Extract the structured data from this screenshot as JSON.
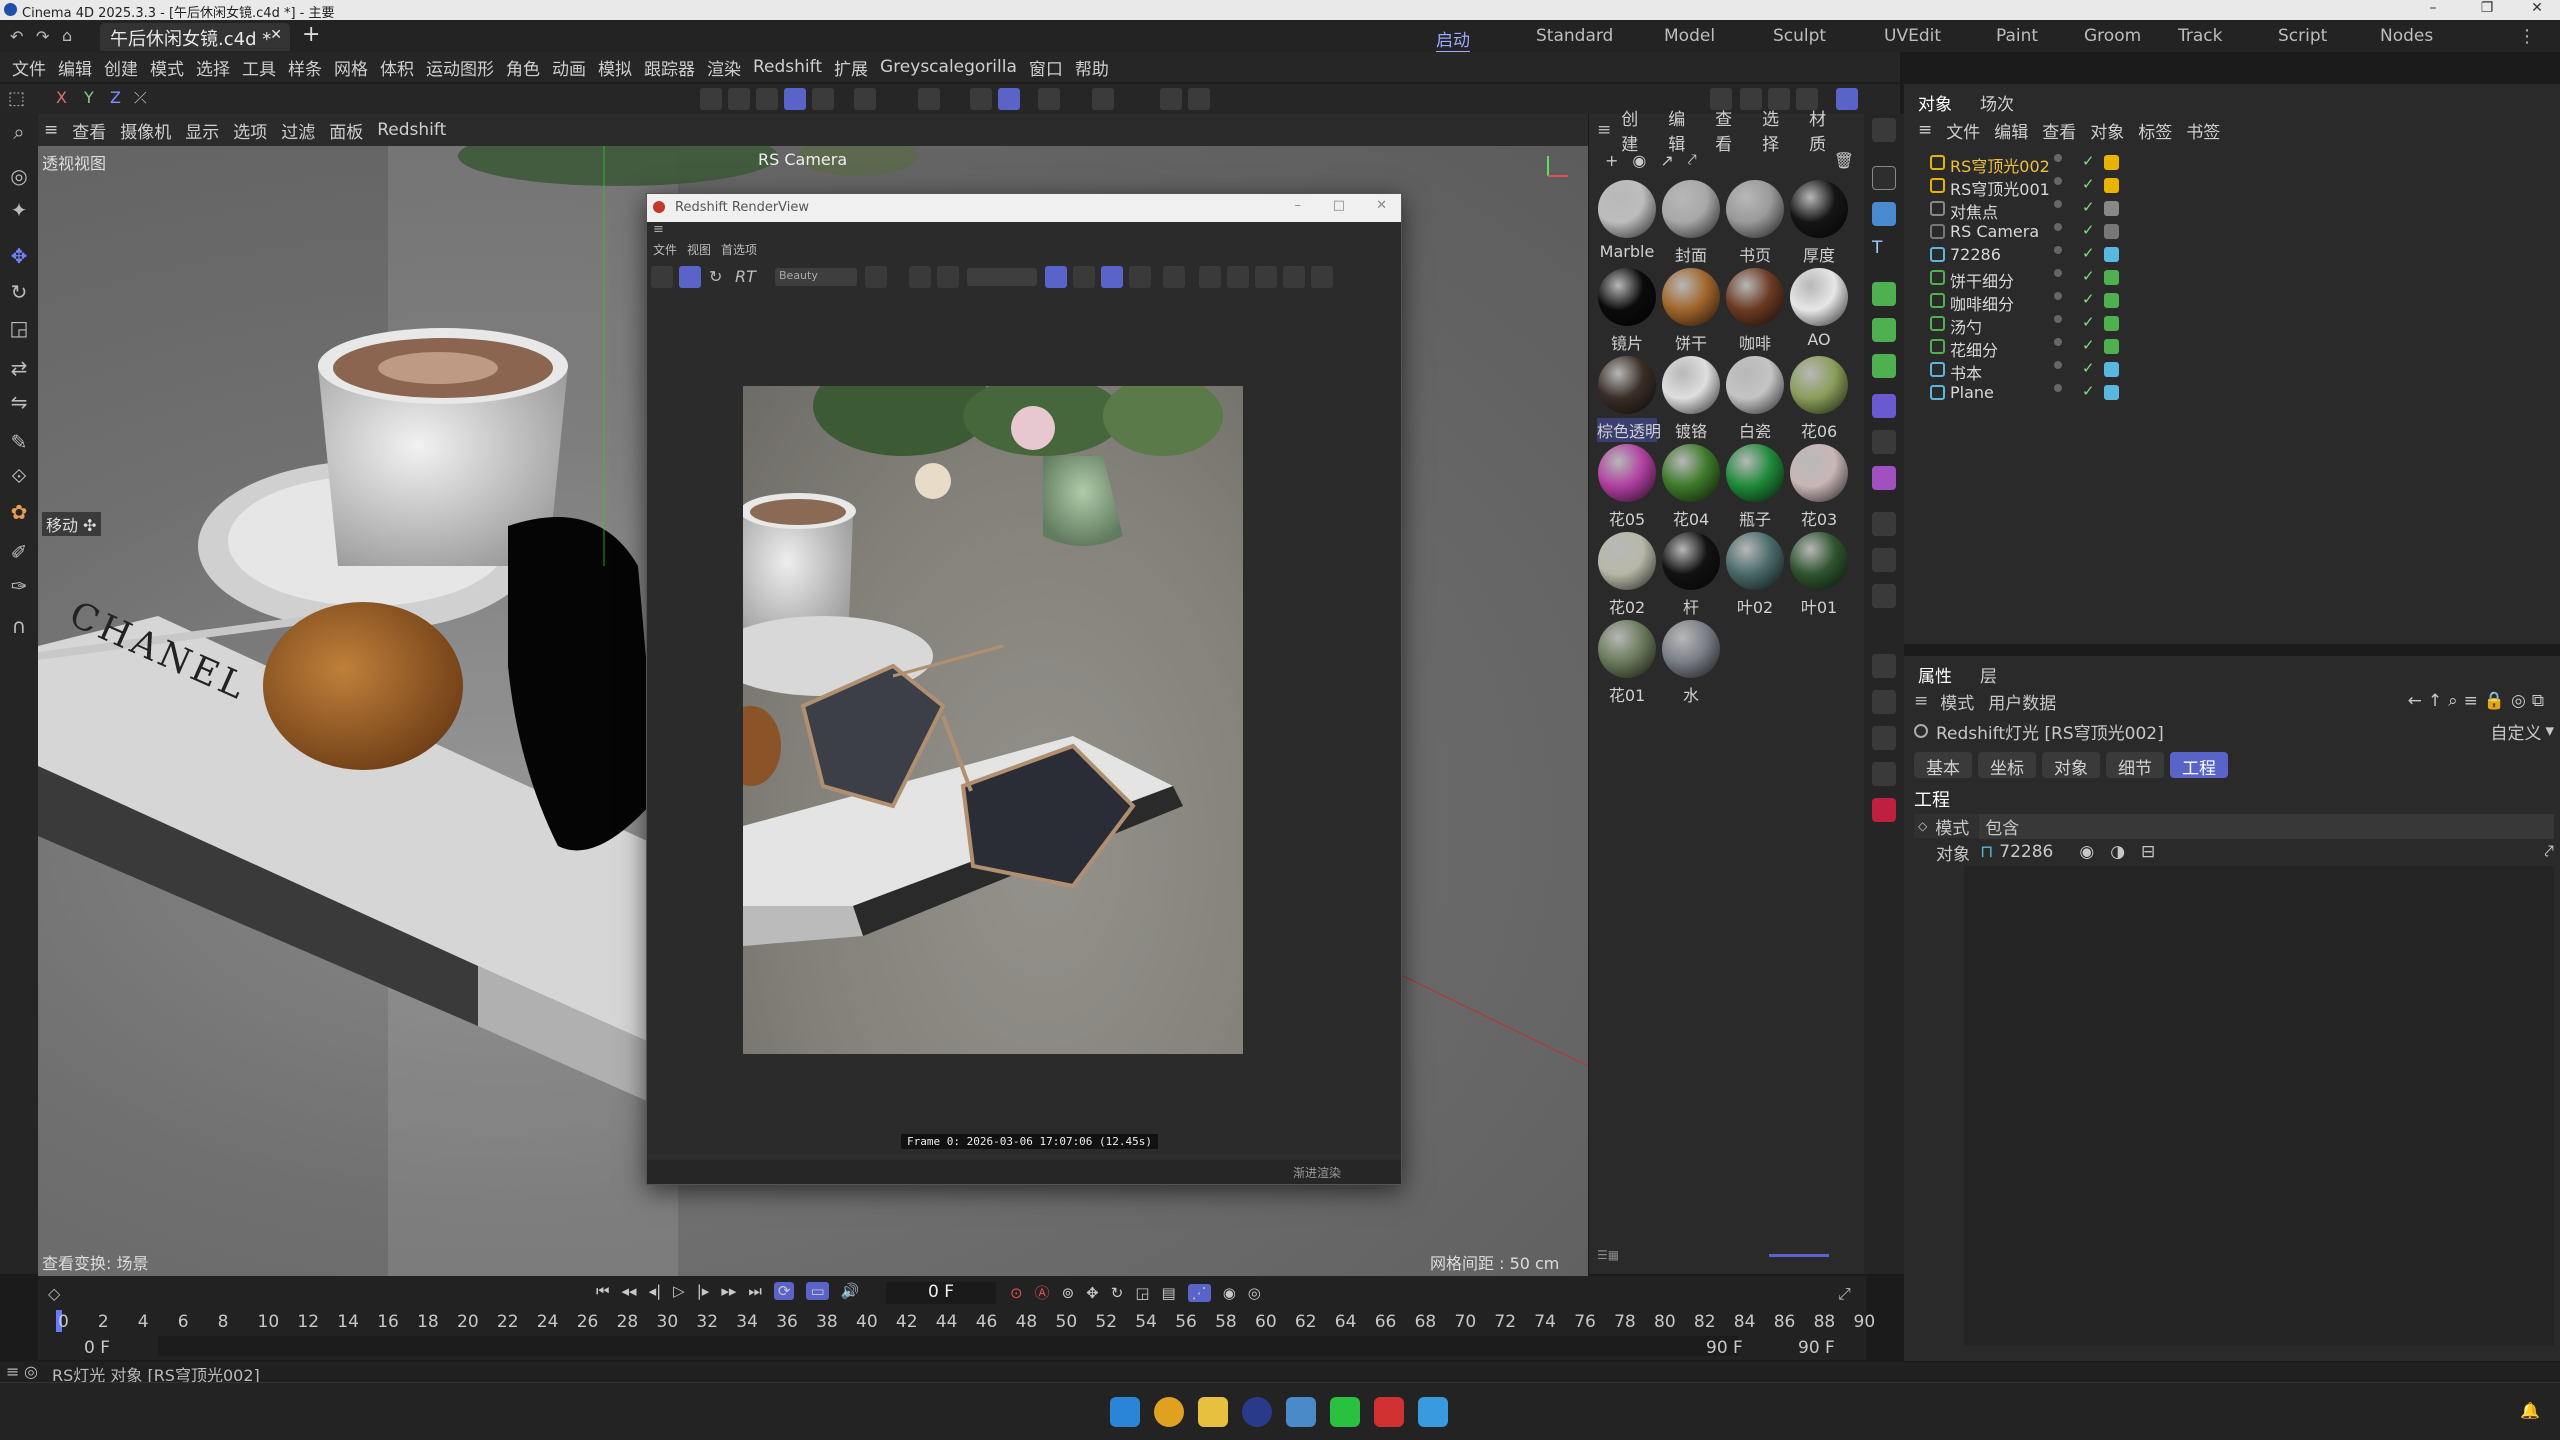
{
  "window": {
    "title": "Cinema 4D 2025.3.3 - [午后休闲女镜.c4d *] - 主要"
  },
  "tabs": {
    "document": "午后休闲女镜.c4d *",
    "add": "+"
  },
  "layouts": [
    {
      "label": "启动",
      "active": true
    },
    {
      "label": "Standard"
    },
    {
      "label": "Model"
    },
    {
      "label": "Sculpt"
    },
    {
      "label": "UVEdit"
    },
    {
      "label": "Paint"
    },
    {
      "label": "Groom"
    },
    {
      "label": "Track"
    },
    {
      "label": "Script"
    },
    {
      "label": "Nodes"
    }
  ],
  "menu": [
    "文件",
    "编辑",
    "创建",
    "模式",
    "选择",
    "工具",
    "样条",
    "网格",
    "体积",
    "运动图形",
    "角色",
    "动画",
    "模拟",
    "跟踪器",
    "渲染",
    "Redshift",
    "扩展",
    "Greyscalegorilla",
    "窗口",
    "帮助"
  ],
  "toolbar_axes": [
    "X",
    "Y",
    "Z"
  ],
  "viewport": {
    "menu": [
      "查看",
      "摄像机",
      "显示",
      "选项",
      "过滤",
      "面板",
      "Redshift"
    ],
    "name": "透视视图",
    "camera": "RS Camera",
    "move_label": "移动 ✣",
    "bottom_left": "查看变换: 场景",
    "grid": "网格间距 : 50 cm",
    "book_text": "CHANEL"
  },
  "renderview": {
    "title": "Redshift RenderView",
    "menu": [
      "文件",
      "视图",
      "首选项"
    ],
    "beauty": "Beauty",
    "rt": "RT",
    "frame": "Frame  0:  2026-03-06  17:07:06  (12.45s)",
    "status": "渐进渲染"
  },
  "materials": {
    "menu": [
      "创建",
      "编辑",
      "查看",
      "选择",
      "材质"
    ],
    "items": [
      {
        "label": "Marble",
        "color": "#bdbdbd"
      },
      {
        "label": "封面",
        "color": "#a8a8a8"
      },
      {
        "label": "书页",
        "color": "#9a9a9a"
      },
      {
        "label": "厚度",
        "color": "#151515"
      },
      {
        "label": "镜片",
        "color": "#0b0b0b"
      },
      {
        "label": "饼干",
        "color": "#a0652a"
      },
      {
        "label": "咖啡",
        "color": "#6b3a22"
      },
      {
        "label": "AO",
        "color": "#e6e6e6"
      },
      {
        "label": "棕色透明",
        "color": "#3a2e26"
      },
      {
        "label": "镀铬",
        "color": "#dedede"
      },
      {
        "label": "白瓷",
        "color": "#c4c4c4"
      },
      {
        "label": "花06",
        "color": "#8a9e5a"
      },
      {
        "label": "花05",
        "color": "#b040a0"
      },
      {
        "label": "花04",
        "color": "#3e7a2a"
      },
      {
        "label": "瓶子",
        "color": "#1f8a3a"
      },
      {
        "label": "花03",
        "color": "#c9b6b6"
      },
      {
        "label": "花02",
        "color": "#b8b8a8"
      },
      {
        "label": "杆",
        "color": "#121212"
      },
      {
        "label": "叶02",
        "color": "#4a6a6a"
      },
      {
        "label": "叶01",
        "color": "#2f5530"
      },
      {
        "label": "花01",
        "color": "#6a7a5a"
      },
      {
        "label": "水",
        "color": "#7a7e86"
      }
    ]
  },
  "objects": {
    "tabs": [
      "对象",
      "场次"
    ],
    "menu": [
      "文件",
      "编辑",
      "查看",
      "对象",
      "标签",
      "书签"
    ],
    "rows": [
      {
        "name": "RS穹顶光002",
        "selected": true,
        "color": "#e8b400"
      },
      {
        "name": "RS穹顶光001",
        "color": "#e8b400"
      },
      {
        "name": "对焦点",
        "color": "#888888"
      },
      {
        "name": "RS Camera",
        "color": "#777777"
      },
      {
        "name": "72286",
        "color": "#5ab8e0"
      },
      {
        "name": "饼干细分",
        "color": "#4fb04f"
      },
      {
        "name": "咖啡细分",
        "color": "#4fb04f"
      },
      {
        "name": "汤勺",
        "color": "#4fb04f"
      },
      {
        "name": "花细分",
        "color": "#4fb04f"
      },
      {
        "name": "书本",
        "color": "#5ab8e0"
      },
      {
        "name": "Plane",
        "color": "#5ab8e0"
      }
    ]
  },
  "attributes": {
    "tabs": [
      "属性",
      "层"
    ],
    "menu": [
      "模式",
      "用户数据"
    ],
    "object_title": "Redshift灯光 [RS穹顶光002]",
    "preset": "自定义",
    "subtabs": [
      {
        "label": "基本"
      },
      {
        "label": "坐标"
      },
      {
        "label": "对象"
      },
      {
        "label": "细节"
      },
      {
        "label": "工程",
        "active": true
      }
    ],
    "section": "工程",
    "mode_label": "模式",
    "mode_value": "包含",
    "object_label": "对象",
    "object_value": "72286"
  },
  "timeline": {
    "current": "0 F",
    "ticks": [
      "0",
      "2",
      "4",
      "6",
      "8",
      "10",
      "12",
      "14",
      "16",
      "18",
      "20",
      "22",
      "24",
      "26",
      "28",
      "30",
      "32",
      "34",
      "36",
      "38",
      "40",
      "42",
      "44",
      "46",
      "48",
      "50",
      "52",
      "54",
      "56",
      "58",
      "60",
      "62",
      "64",
      "66",
      "68",
      "70",
      "72",
      "74",
      "76",
      "78",
      "80",
      "82",
      "84",
      "86",
      "88",
      "90"
    ],
    "start1": "0 F",
    "start2": "0 F",
    "end1": "90 F",
    "end2": "90 F"
  },
  "statusbar": {
    "text": "RS灯光 对象 [RS穹顶光002]"
  },
  "accent": "#5a63c8"
}
